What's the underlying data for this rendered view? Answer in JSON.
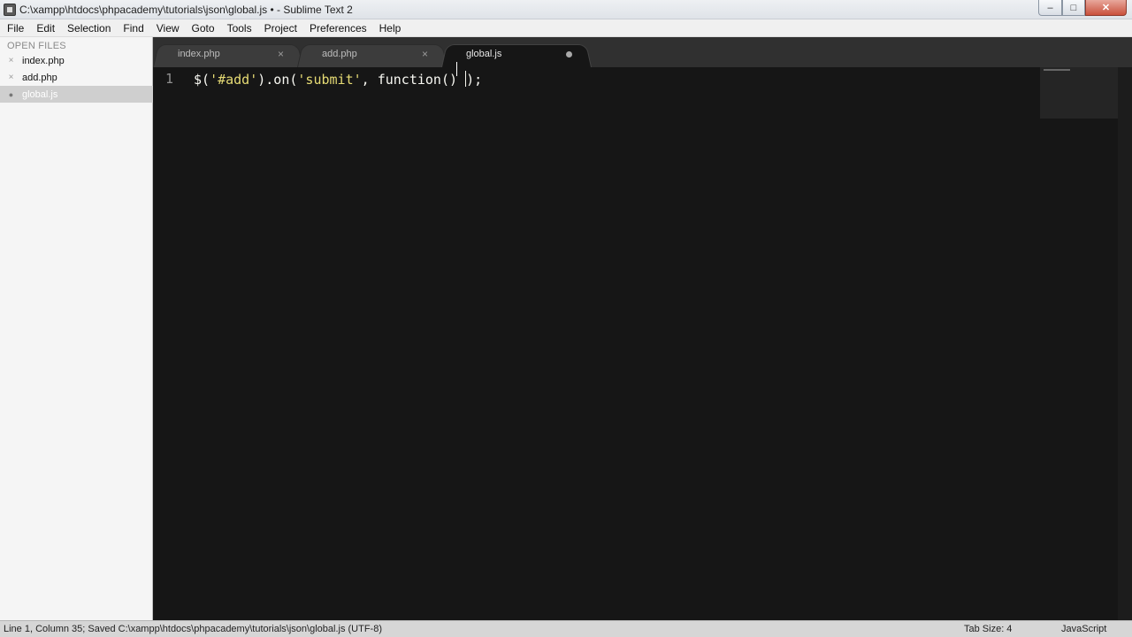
{
  "window": {
    "title": "C:\\xampp\\htdocs\\phpacademy\\tutorials\\json\\global.js • - Sublime Text 2",
    "minimize_label": "–",
    "maximize_label": "□",
    "close_label": "✕"
  },
  "menu": [
    "File",
    "Edit",
    "Selection",
    "Find",
    "View",
    "Goto",
    "Tools",
    "Project",
    "Preferences",
    "Help"
  ],
  "sidebar": {
    "heading": "OPEN FILES",
    "files": [
      {
        "name": "index.php",
        "mark": "×",
        "active": false
      },
      {
        "name": "add.php",
        "mark": "×",
        "active": false
      },
      {
        "name": "global.js",
        "mark": "●",
        "active": true
      }
    ]
  },
  "tabs": [
    {
      "label": "index.php",
      "close": "×",
      "active": false
    },
    {
      "label": "add.php",
      "close": "×",
      "active": false
    },
    {
      "label": "global.js",
      "dirty": true,
      "active": true
    }
  ],
  "editor": {
    "line_number": "1",
    "tokens": {
      "t1": "$(",
      "t2": "'#add'",
      "t3": ").on(",
      "t4": "'submit'",
      "t5": ", function() ",
      "t6": ");"
    },
    "code_text": "$('#add').on('submit', function() );"
  },
  "statusbar": {
    "text": "Line 1, Column 35; Saved C:\\xampp\\htdocs\\phpacademy\\tutorials\\json\\global.js (UTF-8)",
    "tab_size": "Tab Size: 4",
    "syntax": "JavaScript"
  }
}
